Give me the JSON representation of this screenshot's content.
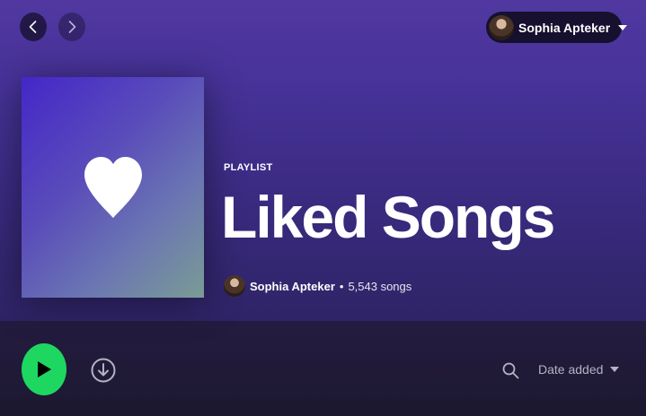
{
  "nav": {
    "back_icon": "chevron-left-icon",
    "forward_icon": "chevron-right-icon"
  },
  "user": {
    "name": "Sophia Apteker",
    "menu_icon": "caret-down-icon"
  },
  "playlist": {
    "type_label": "PLAYLIST",
    "title": "Liked Songs",
    "owner": "Sophia Apteker",
    "separator": "•",
    "song_count": "5,543 songs",
    "cover_icon": "heart-icon"
  },
  "actions": {
    "play_icon": "play-icon",
    "download_icon": "download-icon",
    "search_icon": "search-icon",
    "sort_label": "Date added"
  },
  "colors": {
    "accent": "#1ed760",
    "header_top": "#5038a0",
    "header_bottom": "#2e2466",
    "background": "#1e1832"
  }
}
